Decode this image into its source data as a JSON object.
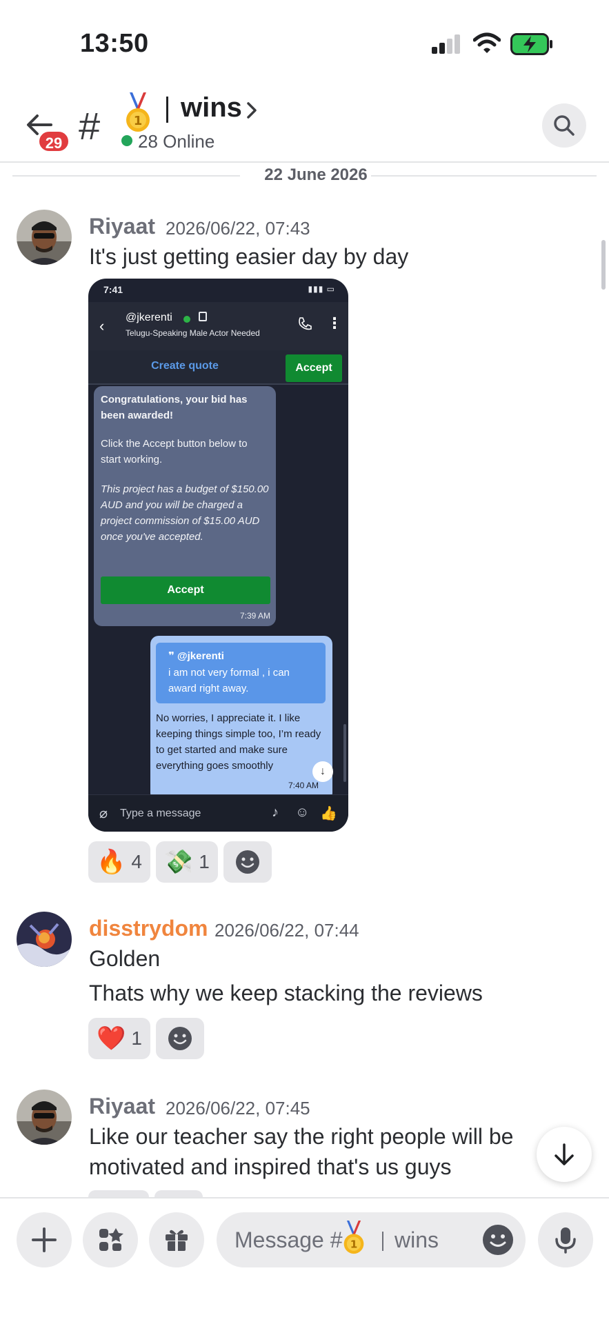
{
  "status_bar": {
    "time": "13:50"
  },
  "header": {
    "unread_count": "29",
    "channel_name": "wins",
    "online": "28 Online"
  },
  "date_divider": "22 June 2026",
  "messages": [
    {
      "author": "Riyaat",
      "timestamp": "2026/06/22, 07:43",
      "lines": [
        "It's just getting easier day by day"
      ],
      "author_color": "#6d6f78",
      "reactions": [
        {
          "emoji": "🔥",
          "icon": "fire",
          "count": "4"
        },
        {
          "emoji": "💸",
          "icon": "money-with-wings",
          "count": "1"
        }
      ]
    },
    {
      "author": "disstrydom",
      "timestamp": "2026/06/22, 07:44",
      "lines": [
        "Golden",
        "Thats why we keep stacking the reviews"
      ],
      "author_color": "#f0853e",
      "reactions": [
        {
          "emoji": "❤️",
          "icon": "red-heart",
          "count": "1"
        }
      ]
    },
    {
      "author": "Riyaat",
      "timestamp": "2026/06/22, 07:45",
      "lines": [
        "Like our teacher say the right people will be",
        "motivated and inspired that's us guys"
      ],
      "author_color": "#6d6f78"
    }
  ],
  "attachment": {
    "status_time": "7:41",
    "username": "@jkerenti",
    "project": "Telugu-Speaking Male Actor Needed",
    "create_quote": "Create quote",
    "accept_top": "Accept",
    "award_title": "Congratulations, your bid has been awarded!",
    "award_body": "Click the Accept button below to start working.",
    "award_terms": "This project has a budget of $150.00 AUD and you will be charged a project commission of $15.00 AUD once you've accepted.",
    "award_button": "Accept",
    "award_time": "7:39 AM",
    "quote_user": "@jkerenti",
    "quote_text": "i am not very formal , i can award right away.",
    "reply_text": "No worries, I appreciate it. I like keeping things simple too, I’m ready to get started and make sure everything goes smoothly",
    "reply_time": "7:40 AM",
    "composer_placeholder": "Type a message"
  },
  "composer": {
    "placeholder_prefix": "Message #",
    "placeholder_channel": "wins"
  },
  "colors": {
    "online_green": "#23a55a",
    "badge_red": "#e13c3f",
    "accept_green": "#108a31"
  }
}
